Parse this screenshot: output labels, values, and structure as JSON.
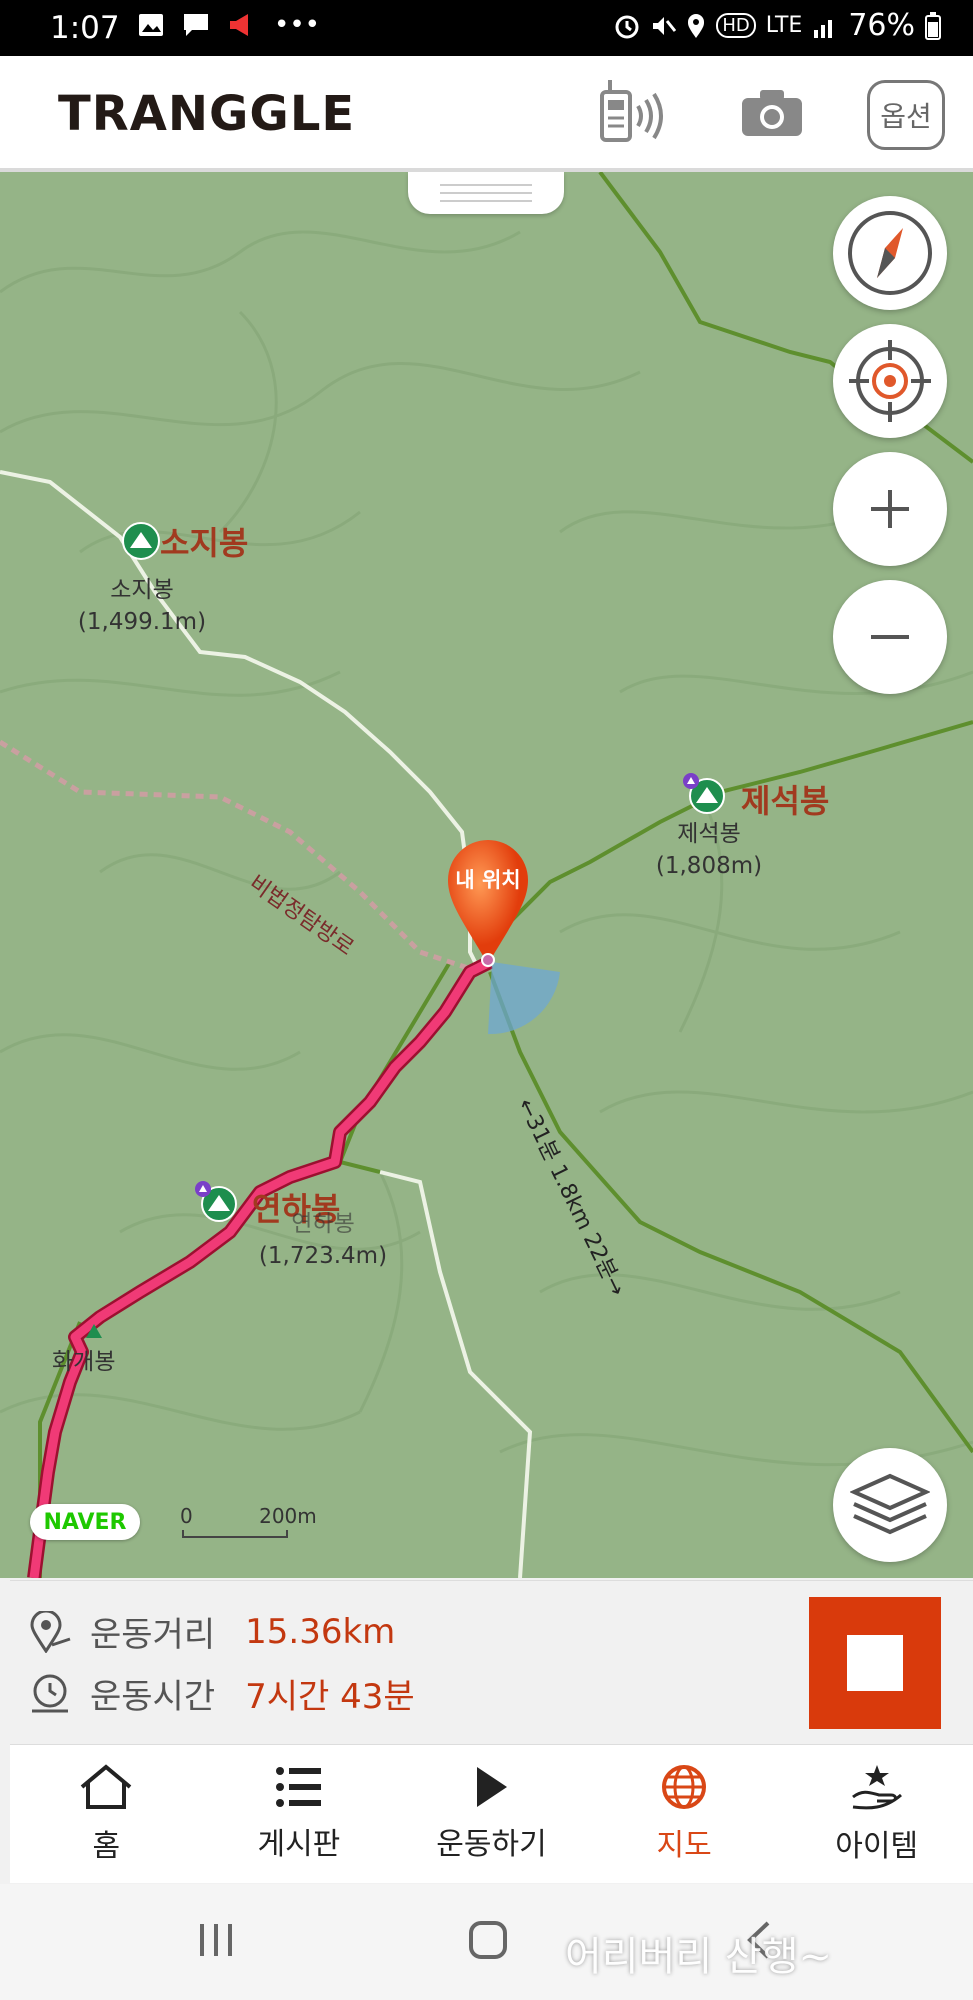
{
  "status_bar": {
    "time": "1:07",
    "network": "LTE",
    "battery": "76%"
  },
  "app": {
    "logo": "TRANGGLE",
    "option_button": "옵션",
    "icons": [
      "walkie-talkie-icon",
      "camera-icon"
    ]
  },
  "map": {
    "peaks": [
      {
        "name": "소지봉",
        "label": "소지봉",
        "elevation": "(1,499.1m)"
      },
      {
        "name": "제석봉",
        "label": "제석봉",
        "elevation": "(1,808m)"
      },
      {
        "name": "연하봉",
        "label": "연하봉",
        "elevation": "(1,723.4m)"
      },
      {
        "name": "화개봉",
        "label": "화개봉"
      }
    ],
    "trail_label": "비법정탐방로",
    "segment_label": "←31분 1.8km 22분→",
    "my_location": "내 위치",
    "provider": "NAVER",
    "scale_zero": "0",
    "scale_dist": "200m",
    "controls": [
      "compass-icon",
      "target-icon",
      "zoom-in-icon",
      "zoom-out-icon",
      "layers-icon"
    ]
  },
  "stats": {
    "distance_label": "운동거리",
    "distance_value": "15.36km",
    "time_label": "운동시간",
    "time_value": "7시간 43분"
  },
  "tabs": [
    {
      "label": "홈",
      "icon": "home-icon",
      "active": false
    },
    {
      "label": "게시판",
      "icon": "list-icon",
      "active": false
    },
    {
      "label": "운동하기",
      "icon": "play-icon",
      "active": false
    },
    {
      "label": "지도",
      "icon": "globe-icon",
      "active": true
    },
    {
      "label": "아이템",
      "icon": "star-hand-icon",
      "active": false
    }
  ],
  "watermark": "어리버리 산행~",
  "colors": {
    "accent": "#d94716",
    "route": "#e8326b",
    "map_bg": "#95b487"
  }
}
